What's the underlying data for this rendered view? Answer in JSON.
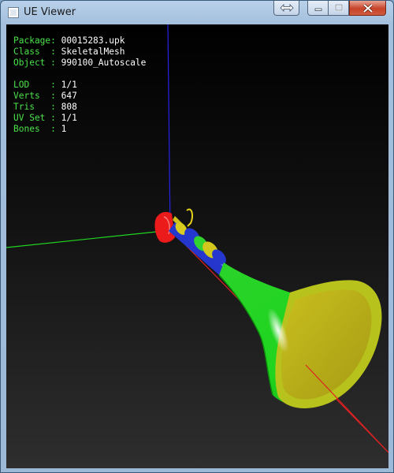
{
  "window": {
    "title": "UE Viewer",
    "buttons": [
      "resize-icon",
      "minimize-icon",
      "maximize-icon",
      "close-icon"
    ]
  },
  "info": {
    "package": {
      "label": "Package:",
      "value": "00015283.upk"
    },
    "class": {
      "label": "Class  :",
      "value": "SkeletalMesh"
    },
    "object": {
      "label": "Object :",
      "value": "990100_Autoscale"
    },
    "lod": {
      "label": "LOD    :",
      "value": "1/1"
    },
    "verts": {
      "label": "Verts  :",
      "value": "647"
    },
    "tris": {
      "label": "Tris   :",
      "value": "808"
    },
    "uvset": {
      "label": "UV Set :",
      "value": "1/1"
    },
    "bones": {
      "label": "Bones  :",
      "value": "1"
    }
  },
  "colors": {
    "label_text": "#4ae24a",
    "value_text": "#ffffff",
    "axis_x": "#e02020",
    "axis_y": "#20d020",
    "axis_z": "#2020e0",
    "mesh_green": "#22dd22",
    "mesh_yellow": "#c8c020",
    "mesh_blue": "#2233cc",
    "mesh_red": "#ee1c1c"
  }
}
